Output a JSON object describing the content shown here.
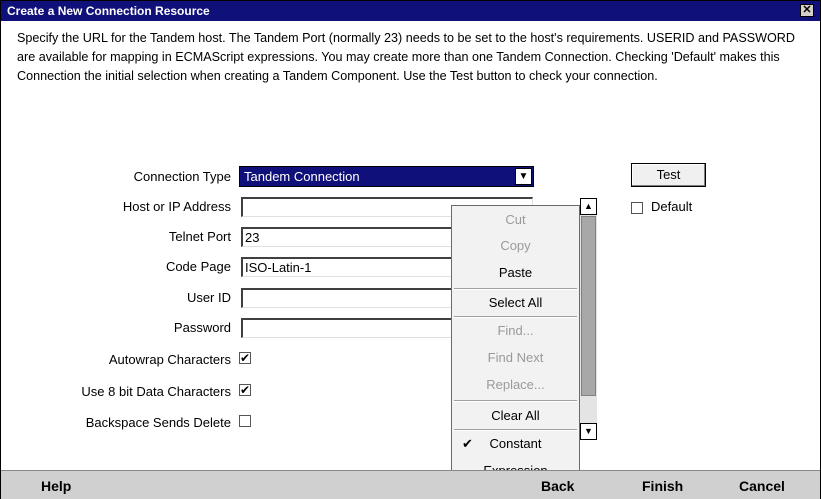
{
  "window": {
    "title": "Create a New Connection Resource",
    "close_glyph": "✕"
  },
  "description": "Specify the URL for the Tandem host.  The Tandem Port (normally 23) needs to be set to the host's requirements.  USERID and PASSWORD are available for mapping in ECMAScript expressions.  You may create more than one Tandem Connection.  Checking 'Default' makes this Connection the initial selection when creating a Tandem Component.  Use the Test button to check your connection.",
  "form": {
    "connection_type": {
      "label": "Connection Type",
      "value": "Tandem Connection",
      "arrow": "▼"
    },
    "host": {
      "label": "Host or IP Address",
      "value": ""
    },
    "telnet_port": {
      "label": "Telnet Port",
      "value": "23"
    },
    "code_page": {
      "label": "Code Page",
      "value": "ISO-Latin-1"
    },
    "user_id": {
      "label": "User ID",
      "value": ""
    },
    "password": {
      "label": "Password",
      "value": ""
    },
    "autowrap": {
      "label": "Autowrap Characters",
      "checked": "✔"
    },
    "eight_bit": {
      "label": "Use 8 bit Data Characters",
      "checked": "✔"
    },
    "backspace": {
      "label": "Backspace Sends Delete",
      "checked": ""
    }
  },
  "test_button": "Test",
  "default_checkbox": {
    "label": "Default",
    "checked": ""
  },
  "context_menu": {
    "cut": "Cut",
    "copy": "Copy",
    "paste": "Paste",
    "select_all": "Select All",
    "find": "Find...",
    "find_next": "Find Next",
    "replace": "Replace...",
    "clear_all": "Clear All",
    "constant": "Constant",
    "constant_check": "✔",
    "expression": "Expression"
  },
  "scrollbar": {
    "up": "▲",
    "down": "▼"
  },
  "footer": {
    "help": "Help",
    "back": "Back",
    "finish": "Finish",
    "cancel": "Cancel"
  },
  "colors": {
    "title_bar": "#10107a",
    "selection": "#10107a",
    "footer": "#d0d0d0"
  }
}
